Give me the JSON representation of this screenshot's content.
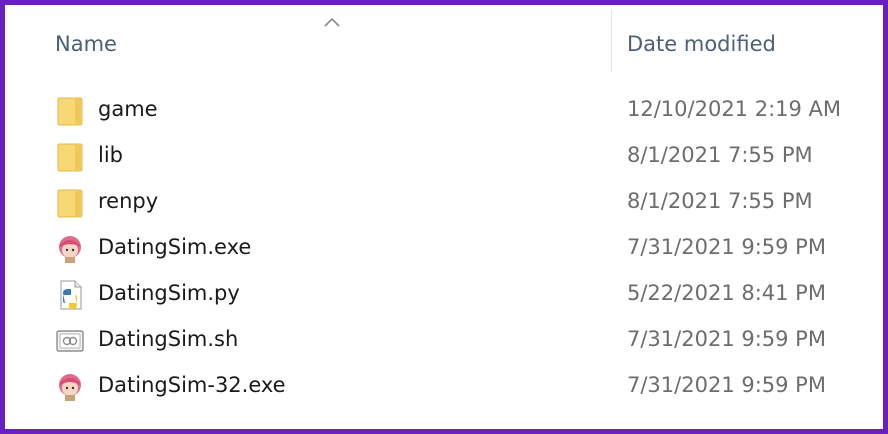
{
  "header": {
    "name_label": "Name",
    "date_label": "Date modified",
    "sort_indicator": "chevron-up-icon"
  },
  "files": [
    {
      "name": "game",
      "date": "12/10/2021 2:19 AM",
      "icon": "folder-icon"
    },
    {
      "name": "lib",
      "date": "8/1/2021 7:55 PM",
      "icon": "folder-icon"
    },
    {
      "name": "renpy",
      "date": "8/1/2021 7:55 PM",
      "icon": "folder-icon"
    },
    {
      "name": "DatingSim.exe",
      "date": "7/31/2021 9:59 PM",
      "icon": "app-character-icon"
    },
    {
      "name": "DatingSim.py",
      "date": "5/22/2021 8:41 PM",
      "icon": "python-file-icon"
    },
    {
      "name": "DatingSim.sh",
      "date": "7/31/2021 9:59 PM",
      "icon": "shell-script-icon"
    },
    {
      "name": "DatingSim-32.exe",
      "date": "7/31/2021 9:59 PM",
      "icon": "app-character-icon"
    }
  ],
  "colors": {
    "frame_border": "#6a1fc2",
    "folder": "#f8d775",
    "header_text": "#4c607a"
  }
}
